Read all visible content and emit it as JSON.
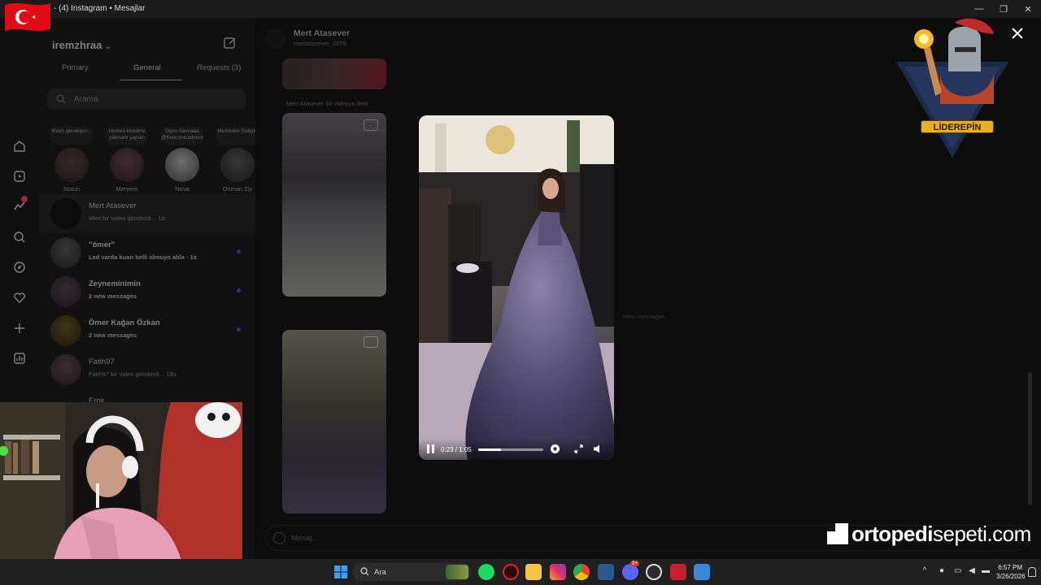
{
  "window": {
    "title": "(4) Instagram • Mesajlar",
    "title_prefix": "- ",
    "accent": "#2b3c86"
  },
  "inbox": {
    "username": "iremzhraa",
    "tabs": [
      {
        "label": "Primary",
        "active": false
      },
      {
        "label": "General",
        "active": true
      },
      {
        "label": "Requests (3)",
        "active": false
      }
    ],
    "search_placeholder": "Arama",
    "notes": [
      {
        "text": "İlham gerekiyor...",
        "name": "Notun"
      },
      {
        "text": "Herkes kendine yakisani yapsin",
        "name": "Meryem"
      },
      {
        "text": "Dgko havvaaa @theiconicadventuresofevaa",
        "name": "Nova"
      },
      {
        "text": "Mezeleke Gidiştir",
        "name": "Osman Ziy"
      }
    ],
    "conversations": [
      {
        "name": "Mert Atasever",
        "preview": "Mert bir video gönderdi. · 1d",
        "selected": true,
        "unread": false
      },
      {
        "name": "\"ömer\"",
        "preview": "Led varda kuan belli olmuyo abla · 1s",
        "selected": false,
        "unread": true
      },
      {
        "name": "Zeyneminimin",
        "preview": "2 new messages",
        "selected": false,
        "unread": true
      },
      {
        "name": "Ömer Kağan Özkan",
        "preview": "2 new messages",
        "selected": false,
        "unread": true
      },
      {
        "name": "Fatih97",
        "preview": "Fatih97 bir video gönderdi. · 19s",
        "selected": false,
        "unread": false
      },
      {
        "name": "Emir",
        "preview": "",
        "selected": false,
        "unread": false
      }
    ]
  },
  "chat": {
    "name": "Mert Atasever",
    "handle": "mertatasever_1079",
    "system_message": "Mert Atasever bir videoyu iletti",
    "new_messages_label": "New messages",
    "composer_placeholder": "Mesaj..."
  },
  "player": {
    "time": "0:23 / 1:05",
    "progress": 0.354
  },
  "overlays": {
    "badge_text": "LİDEREPİN",
    "watermark_bold": "ortopedi",
    "watermark_rest": "sepeti.com"
  },
  "taskbar": {
    "search_placeholder": "Ara",
    "time": "6:57 PM",
    "date": "3/26/2026",
    "notification_count": "9+"
  }
}
